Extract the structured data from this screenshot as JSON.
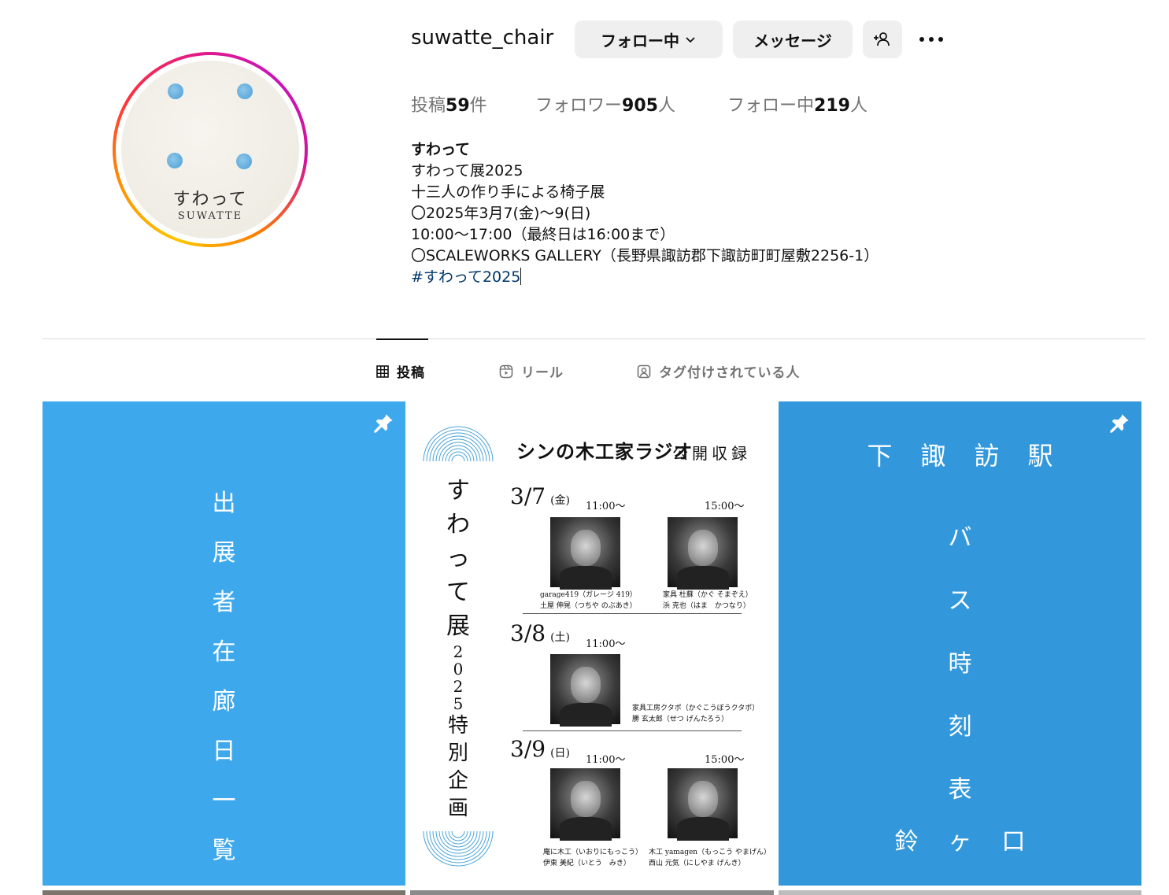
{
  "profile": {
    "username": "suwatte_chair",
    "logo_jp": "すわって",
    "logo_en": "SUWATTE",
    "follow_label": "フォロー中",
    "message_label": "メッセージ",
    "stats": {
      "posts_prefix": "投稿",
      "posts_count": "59",
      "posts_suffix": "件",
      "followers_prefix": "フォロワー",
      "followers_count": "905",
      "followers_suffix": "人",
      "following_prefix": "フォロー中",
      "following_count": "219",
      "following_suffix": "人"
    },
    "bio": {
      "name": "すわって",
      "lines": [
        "すわって展2025",
        "十三人の作り手による椅子展",
        "〇2025年3月7(金)〜9(日)",
        "10:00〜17:00（最終日は16:00まで）",
        "〇SCALEWORKS GALLERY（長野県諏訪郡下諏訪町町屋敷2256-1）"
      ],
      "hashtag": "#すわって2025"
    }
  },
  "tabs": [
    {
      "label": "投稿",
      "icon": "grid-icon",
      "active": true
    },
    {
      "label": "リール",
      "icon": "reels-icon",
      "active": false
    },
    {
      "label": "タグ付けされている人",
      "icon": "tagged-icon",
      "active": false
    }
  ],
  "posts": {
    "post1": {
      "text": [
        "出",
        "展",
        "者",
        "在",
        "廊",
        "日",
        "一",
        "覧"
      ],
      "bg": "#3ea8ed"
    },
    "post2": {
      "vertical_main": [
        "す",
        "わ",
        "っ",
        "て",
        "展"
      ],
      "vertical_year": [
        "2",
        "0",
        "2",
        "5"
      ],
      "vertical_sub": [
        "特",
        "別",
        "企",
        "画"
      ],
      "radio_title": "シンの木工家ラジオ",
      "radio_sub": "公開収録",
      "days": [
        {
          "date": "3/7",
          "dow": "(金)"
        },
        {
          "date": "3/8",
          "dow": "(土)"
        },
        {
          "date": "3/9",
          "dow": "(日)"
        }
      ],
      "times": {
        "t1": "11:00〜",
        "t2": "15:00〜"
      },
      "captions": {
        "c1a": "garage419（ガレージ 419）",
        "c1b": "土屋 伸晃（つちや のぶあき）",
        "c2a": "家具 杜蘇（かぐ そまぞえ）",
        "c2b": "浜 克也（はま　かつなり）",
        "c3a": "家具工房クタポ（かぐこうぼうクタポ）",
        "c3b": "勝 玄太郎（せつ げんたろう）",
        "c4a": "庵に木工（いおりにもっこう）",
        "c4b": "伊東 美紀（いとう　みき）",
        "c5a": "木工 yamagen（もっこう やまげん）",
        "c5b": "西山 元気（にしやま げんき）"
      }
    },
    "post3": {
      "title": "下諏訪駅",
      "text": [
        "バ",
        "ス",
        "時",
        "刻",
        "表"
      ],
      "bottom": "鈴ヶ口",
      "bg": "#3398db"
    }
  },
  "colors": {
    "hashtag": "#00376b",
    "button_bg": "#efefef",
    "muted": "#737373"
  }
}
